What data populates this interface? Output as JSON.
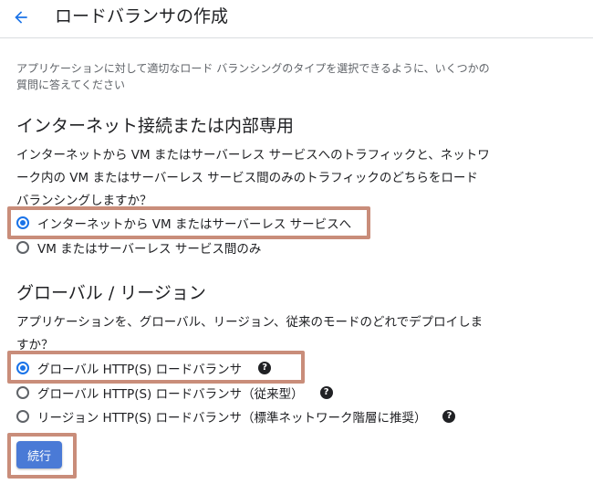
{
  "header": {
    "title": "ロードバランサの作成",
    "back_icon": "arrow-back-icon"
  },
  "intro": "アプリケーションに対して適切なロード バランシングのタイプを選択できるように、いくつかの質問に答えてください",
  "section1": {
    "title": "インターネット接続または内部専用",
    "question": "インターネットから VM またはサーバーレス サービスへのトラフィックと、ネットワーク内の VM またはサーバーレス サービス間のみのトラフィックのどちらをロード バランシングしますか？",
    "options": [
      {
        "label": "インターネットから VM またはサーバーレス サービスへ",
        "selected": true
      },
      {
        "label": "VM またはサーバーレス サービス間のみ",
        "selected": false
      }
    ]
  },
  "section2": {
    "title": "グローバル / リージョン",
    "question": "アプリケーションを、グローバル、リージョン、従来のモードのどれでデプロイしますか？",
    "options": [
      {
        "label": "グローバル HTTP(S) ロードバランサ",
        "selected": true,
        "help_icon": "help-icon"
      },
      {
        "label": "グローバル HTTP(S) ロードバランサ（従来型）",
        "selected": false,
        "help_icon": "help-icon"
      },
      {
        "label": "リージョン HTTP(S) ロードバランサ（標準ネットワーク階層に推奨）",
        "selected": false,
        "help_icon": "help-icon"
      }
    ]
  },
  "continue_label": "続行",
  "colors": {
    "accent": "#1a73e8",
    "button": "#4a7ad6",
    "highlight": "#c98d7a"
  }
}
